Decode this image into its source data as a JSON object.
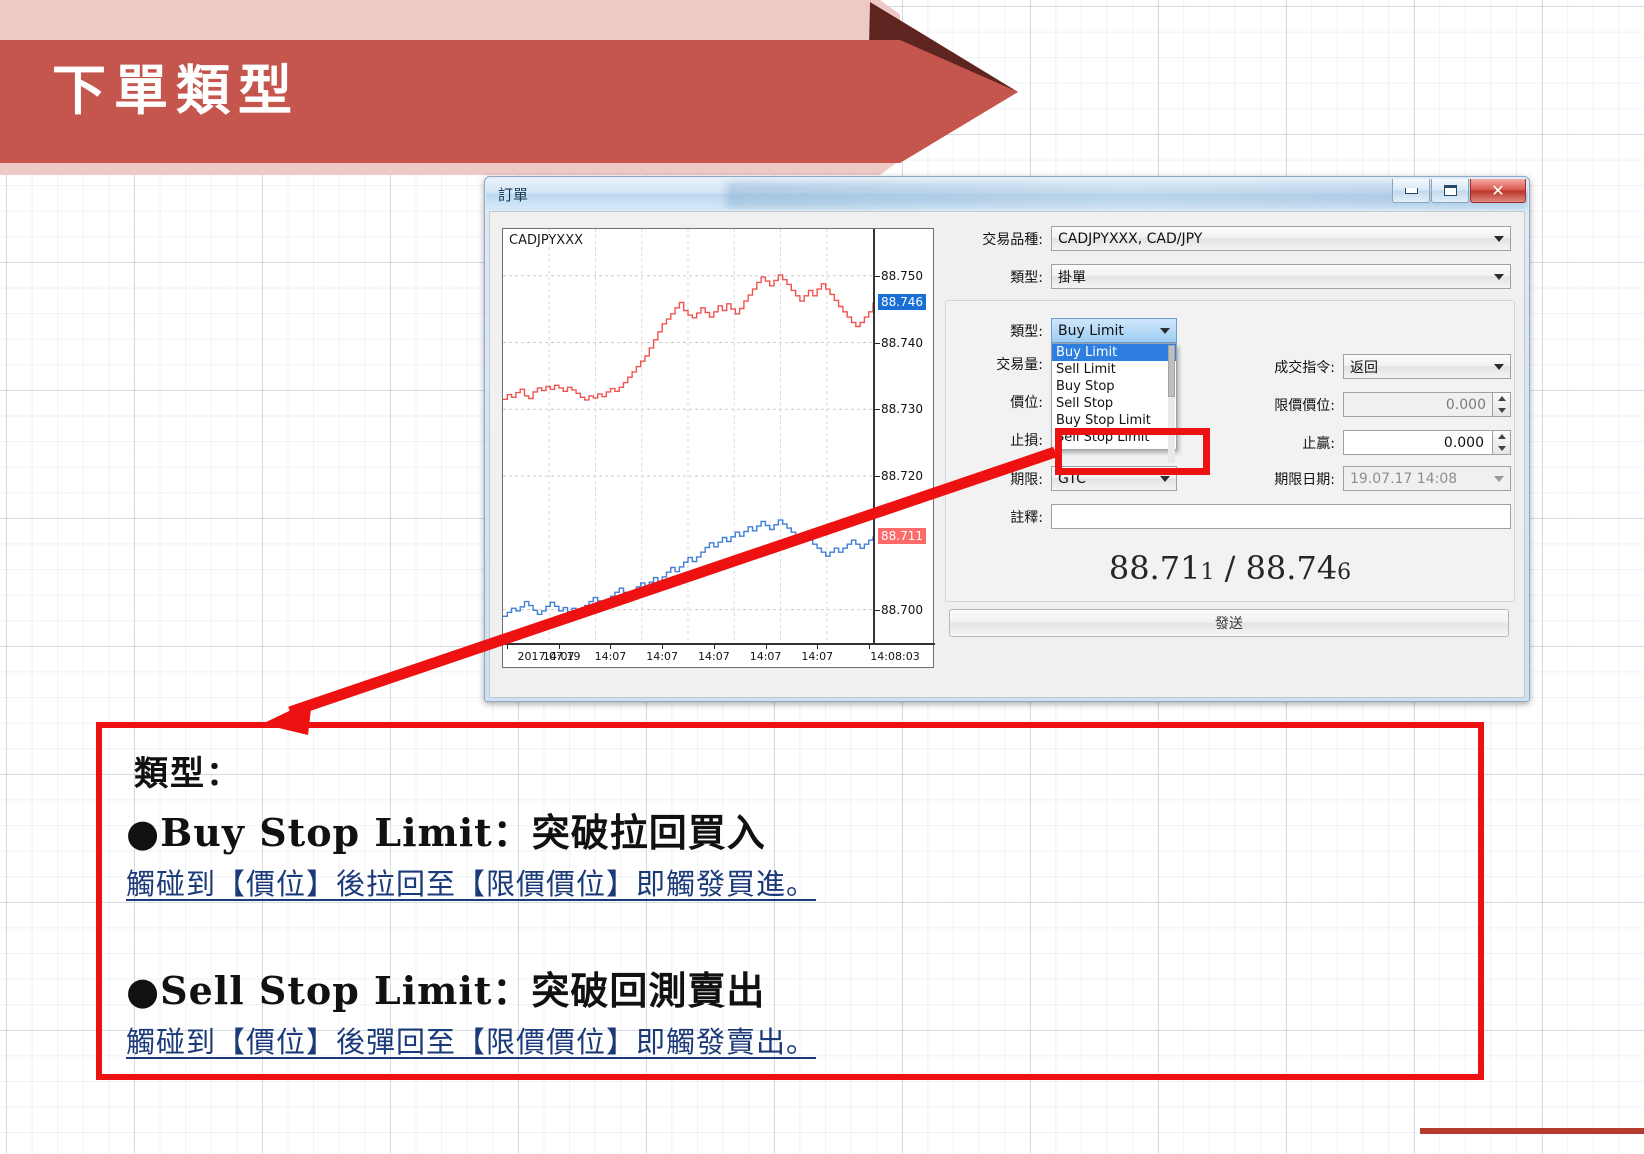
{
  "slide": {
    "title": "下單類型",
    "banner_color": "#c5564e",
    "banner_light_color": "#efc9c6",
    "banner_dark_color": "#5e2420"
  },
  "window": {
    "title": "訂單",
    "controls": {
      "minimize": "minimize",
      "maximize": "maximize",
      "close": "✕"
    }
  },
  "chart": {
    "symbol": "CADJPYXXX"
  },
  "chart_data": {
    "type": "line",
    "title": "CADJPYXXX",
    "xlabel": "",
    "ylabel": "",
    "ylim": [
      88.695,
      88.757
    ],
    "grid": true,
    "legend": false,
    "y_ticks": [
      "88.750",
      "88.740",
      "88.730",
      "88.720",
      "88.700"
    ],
    "y_tick_values": [
      88.75,
      88.74,
      88.73,
      88.72,
      88.7
    ],
    "x_ticks": [
      "2017.07.19",
      "14:07",
      "14:07",
      "14:07",
      "14:07",
      "14:07",
      "14:07",
      "14:08:03"
    ],
    "price_labels": [
      {
        "value": "88.746",
        "color": "#fd6a6a",
        "series": "ask"
      },
      {
        "value": "88.711",
        "color": "#1a6fd4",
        "series": "bid"
      }
    ],
    "series": [
      {
        "name": "ask",
        "color": "#f0534f",
        "values": [
          88.7315,
          88.7322,
          88.7318,
          88.7325,
          88.733,
          88.732,
          88.7316,
          88.7326,
          88.7332,
          88.7328,
          88.7334,
          88.733,
          88.7336,
          88.7332,
          88.7327,
          88.7333,
          88.7329,
          88.7324,
          88.7318,
          88.7314,
          88.732,
          88.7317,
          88.7323,
          88.7319,
          88.7326,
          88.7331,
          88.7327,
          88.7333,
          88.734,
          88.7348,
          88.7356,
          88.7364,
          88.7372,
          88.738,
          88.7392,
          88.7404,
          88.7416,
          88.7428,
          88.7435,
          88.7443,
          88.7452,
          88.746,
          88.7448,
          88.7441,
          88.7437,
          88.7444,
          88.7452,
          88.7445,
          88.7438,
          88.7446,
          88.7455,
          88.7448,
          88.7458,
          88.745,
          88.7443,
          88.7451,
          88.7462,
          88.7471,
          88.748,
          88.749,
          88.7498,
          88.7492,
          88.7485,
          88.7493,
          88.7501,
          88.7494,
          88.7487,
          88.7478,
          88.747,
          88.7462,
          88.747,
          88.7478,
          88.747,
          88.748,
          88.7488,
          88.748,
          88.7472,
          88.7463,
          88.7454,
          88.7446,
          88.7438,
          88.743,
          88.7424,
          88.743,
          88.7438,
          88.7446,
          88.746
        ]
      },
      {
        "name": "bid",
        "color": "#3f7fd8",
        "values": [
          88.699,
          88.6996,
          88.7002,
          88.6998,
          88.7004,
          88.7012,
          88.7006,
          88.6999,
          88.6993,
          88.6998,
          88.7005,
          88.7011,
          88.7005,
          88.6998,
          88.7003,
          88.6997,
          88.7002,
          88.6996,
          88.7,
          88.7006,
          88.7012,
          88.7018,
          88.7013,
          88.7008,
          88.7014,
          88.702,
          88.7026,
          88.7032,
          88.7026,
          88.702,
          88.7027,
          88.7034,
          88.704,
          88.7034,
          88.7041,
          88.7048,
          88.7042,
          88.7049,
          88.7056,
          88.7063,
          88.7057,
          88.7064,
          88.7071,
          88.7078,
          88.7072,
          88.7079,
          88.7086,
          88.7093,
          88.71,
          88.7094,
          88.7101,
          88.7108,
          88.7102,
          88.7109,
          88.7116,
          88.711,
          88.7117,
          88.7124,
          88.7118,
          88.7125,
          88.7132,
          88.7126,
          88.712,
          88.7127,
          88.7134,
          88.7128,
          88.7122,
          88.7116,
          88.711,
          88.7104,
          88.711,
          88.7104,
          88.7098,
          88.7092,
          88.7086,
          88.708,
          88.7086,
          88.7092,
          88.7086,
          88.7092,
          88.7098,
          88.7104,
          88.7098,
          88.7092,
          88.7098,
          88.7104,
          88.711
        ]
      }
    ]
  },
  "form": {
    "symbol_label": "交易品種:",
    "symbol_value": "CADJPYXXX, CAD/JPY",
    "order_type_label": "類型:",
    "order_type_value": "掛單",
    "pending_type_label": "類型:",
    "pending_type_value": "Buy Limit",
    "volume_label": "交易量:",
    "price_label": "價位:",
    "stoploss_label": "止損:",
    "expiry_label": "期限:",
    "expiry_value": "GTC",
    "comment_label": "註釋:",
    "comment_value": "",
    "fill_policy_label": "成交指令:",
    "fill_policy_value": "返回",
    "limit_price_label": "限價價位:",
    "limit_price_value": "0.000",
    "takeprofit_label": "止贏:",
    "takeprofit_value": "0.000",
    "expiry_date_label": "期限日期:",
    "expiry_date_value": "19.07.17 14:08",
    "quote_bid": "88.71",
    "quote_bid_sub": "1",
    "quote_sep": "/",
    "quote_ask": "88.74",
    "quote_ask_sub": "6",
    "send_label": "發送"
  },
  "dropdown": {
    "items": [
      {
        "label": "Buy Limit",
        "selected": true
      },
      {
        "label": "Sell Limit",
        "selected": false
      },
      {
        "label": "Buy Stop",
        "selected": false
      },
      {
        "label": "Sell Stop",
        "selected": false
      },
      {
        "label": "Buy Stop Limit",
        "selected": false
      },
      {
        "label": "Sell Stop Limit",
        "selected": false
      }
    ]
  },
  "callout": {
    "heading": "類型：",
    "item1_title": "●Buy Stop Limit：突破拉回買入",
    "item1_desc": "觸碰到【價位】後拉回至【限價價位】即觸發買進。",
    "item2_title": "●Sell Stop Limit：突破回測賣出",
    "item2_desc": "觸碰到【價位】後彈回至【限價價位】即觸發賣出。",
    "border_color": "#ee1111",
    "desc_color": "#1b3a7a"
  }
}
